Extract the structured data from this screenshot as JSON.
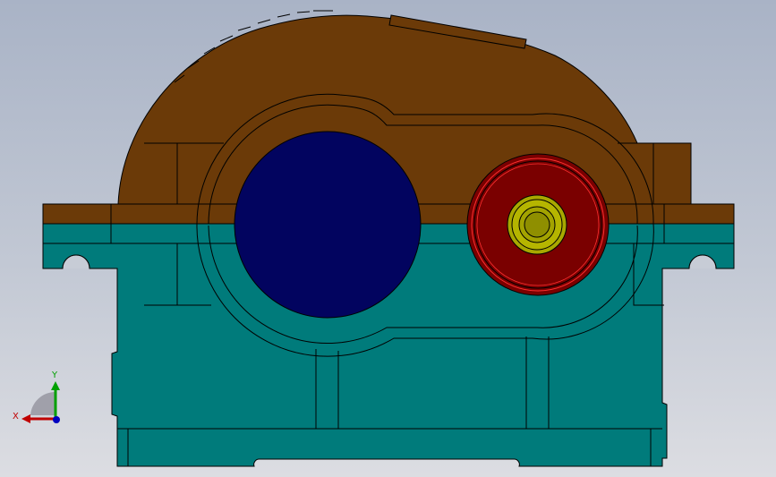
{
  "viewport": {
    "colors": {
      "cover": "#6b3a08",
      "base": "#007b7b",
      "large_bore": "#02045f",
      "gear": "#7a0000",
      "bearing": "#a8a800",
      "outline": "#000000"
    }
  },
  "triad": {
    "x_label": "X",
    "y_label": "Y",
    "colors": {
      "x_axis": "#c00000",
      "y_axis": "#00a000",
      "z_axis": "#0000c0"
    }
  }
}
